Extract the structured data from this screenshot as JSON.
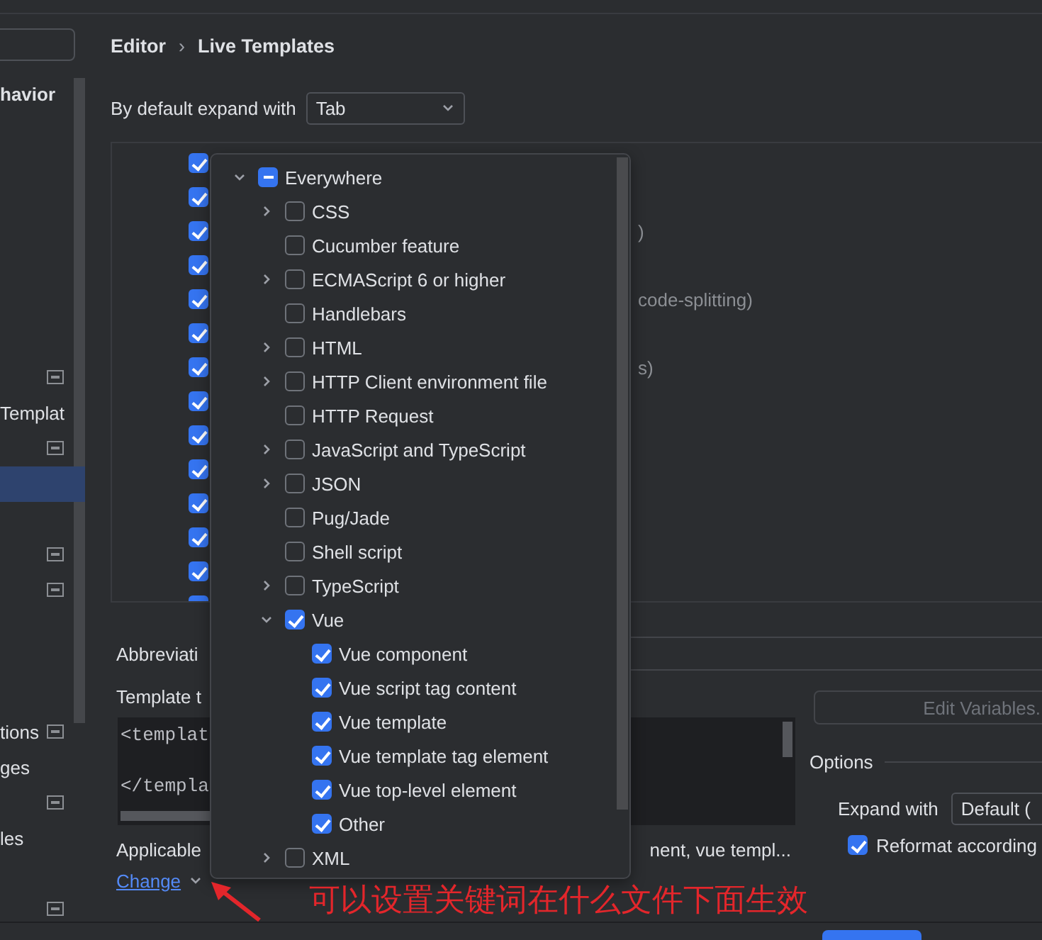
{
  "sidebar": {
    "rows": [
      {
        "text": "havior",
        "icon": false,
        "selected": false
      },
      {
        "icon": false,
        "selected": false
      },
      {
        "icon": false,
        "selected": false
      },
      {
        "icon": false,
        "selected": false
      },
      {
        "icon": false,
        "selected": false
      },
      {
        "icon": false,
        "selected": false
      },
      {
        "icon": false,
        "selected": false
      },
      {
        "icon": false,
        "selected": false
      },
      {
        "icon": true,
        "selected": false
      },
      {
        "text": "Templat",
        "icon": false,
        "selected": false
      },
      {
        "icon": true,
        "selected": false
      },
      {
        "icon": false,
        "selected": true
      },
      {
        "icon": false,
        "selected": false
      },
      {
        "icon": true,
        "selected": false
      },
      {
        "icon": true,
        "selected": false
      },
      {
        "icon": false,
        "selected": false
      },
      {
        "icon": false,
        "selected": false
      },
      {
        "icon": false,
        "selected": false
      },
      {
        "text": "tions",
        "icon": true,
        "selected": false
      },
      {
        "text": "ges",
        "icon": false,
        "selected": false
      },
      {
        "icon": true,
        "selected": false
      },
      {
        "text": "les",
        "icon": false,
        "selected": false
      },
      {
        "icon": false,
        "selected": false
      },
      {
        "icon": true,
        "selected": false
      }
    ]
  },
  "breadcrumb": {
    "items": [
      "Editor",
      "Live Templates"
    ],
    "separator": "›"
  },
  "expand_default": {
    "label": "By default expand with",
    "value": "Tab"
  },
  "template_rows": [
    {
      "checked": true
    },
    {
      "checked": true
    },
    {
      "checked": true,
      "description": ")"
    },
    {
      "checked": true
    },
    {
      "checked": true,
      "description": "code-splitting)"
    },
    {
      "checked": true
    },
    {
      "checked": true,
      "description": "s)"
    },
    {
      "checked": true
    },
    {
      "checked": true
    },
    {
      "checked": true
    },
    {
      "checked": true
    },
    {
      "checked": true
    },
    {
      "checked": true
    },
    {
      "checked": true
    }
  ],
  "abbreviation": {
    "label": "Abbreviati"
  },
  "template_text": {
    "label": "Template t",
    "lines": [
      "<templat",
      "</templa"
    ]
  },
  "applicable": {
    "label": "Applicable",
    "contexts": "nent, vue templ..."
  },
  "change_link": {
    "label": "Change"
  },
  "edit_variables": {
    "label": "Edit Variables.",
    "disabled": true
  },
  "options": {
    "title": "Options",
    "expand_with": {
      "label": "Expand with",
      "value": "Default ("
    },
    "reformat": {
      "label": "Reformat according",
      "checked": true
    }
  },
  "context_popup": {
    "tree": [
      {
        "label": "Everywhere",
        "kind": "group",
        "expanded": true,
        "checked": true,
        "partial": true,
        "children": [
          {
            "label": "CSS",
            "kind": "group",
            "expanded": false,
            "checked": false,
            "partial": false
          },
          {
            "label": "Cucumber feature",
            "kind": "leaf",
            "checked": false,
            "partial": false
          },
          {
            "label": "ECMAScript 6 or higher",
            "kind": "group",
            "expanded": false,
            "checked": false,
            "partial": false
          },
          {
            "label": "Handlebars",
            "kind": "leaf",
            "checked": false,
            "partial": false
          },
          {
            "label": "HTML",
            "kind": "group",
            "expanded": false,
            "checked": false,
            "partial": false
          },
          {
            "label": "HTTP Client environment file",
            "kind": "group",
            "expanded": false,
            "checked": false,
            "partial": false
          },
          {
            "label": "HTTP Request",
            "kind": "leaf",
            "checked": false,
            "partial": false
          },
          {
            "label": "JavaScript and TypeScript",
            "kind": "group",
            "expanded": false,
            "checked": false,
            "partial": false
          },
          {
            "label": "JSON",
            "kind": "group",
            "expanded": false,
            "checked": false,
            "partial": false
          },
          {
            "label": "Pug/Jade",
            "kind": "leaf",
            "checked": false,
            "partial": false
          },
          {
            "label": "Shell script",
            "kind": "leaf",
            "checked": false,
            "partial": false
          },
          {
            "label": "TypeScript",
            "kind": "group",
            "expanded": false,
            "checked": false,
            "partial": false
          },
          {
            "label": "Vue",
            "kind": "group",
            "expanded": true,
            "checked": true,
            "partial": false,
            "children": [
              {
                "label": "Vue component",
                "kind": "leaf",
                "checked": true,
                "partial": false
              },
              {
                "label": "Vue script tag content",
                "kind": "leaf",
                "checked": true,
                "partial": false
              },
              {
                "label": "Vue template",
                "kind": "leaf",
                "checked": true,
                "partial": false
              },
              {
                "label": "Vue template tag element",
                "kind": "leaf",
                "checked": true,
                "partial": false
              },
              {
                "label": "Vue top-level element",
                "kind": "leaf",
                "checked": true,
                "partial": false
              },
              {
                "label": "Other",
                "kind": "leaf",
                "checked": true,
                "partial": false
              }
            ]
          },
          {
            "label": "XML",
            "kind": "group",
            "expanded": false,
            "checked": false,
            "partial": false
          }
        ]
      }
    ]
  },
  "annotation": {
    "text": "可以设置关键词在什么文件下面生效"
  }
}
